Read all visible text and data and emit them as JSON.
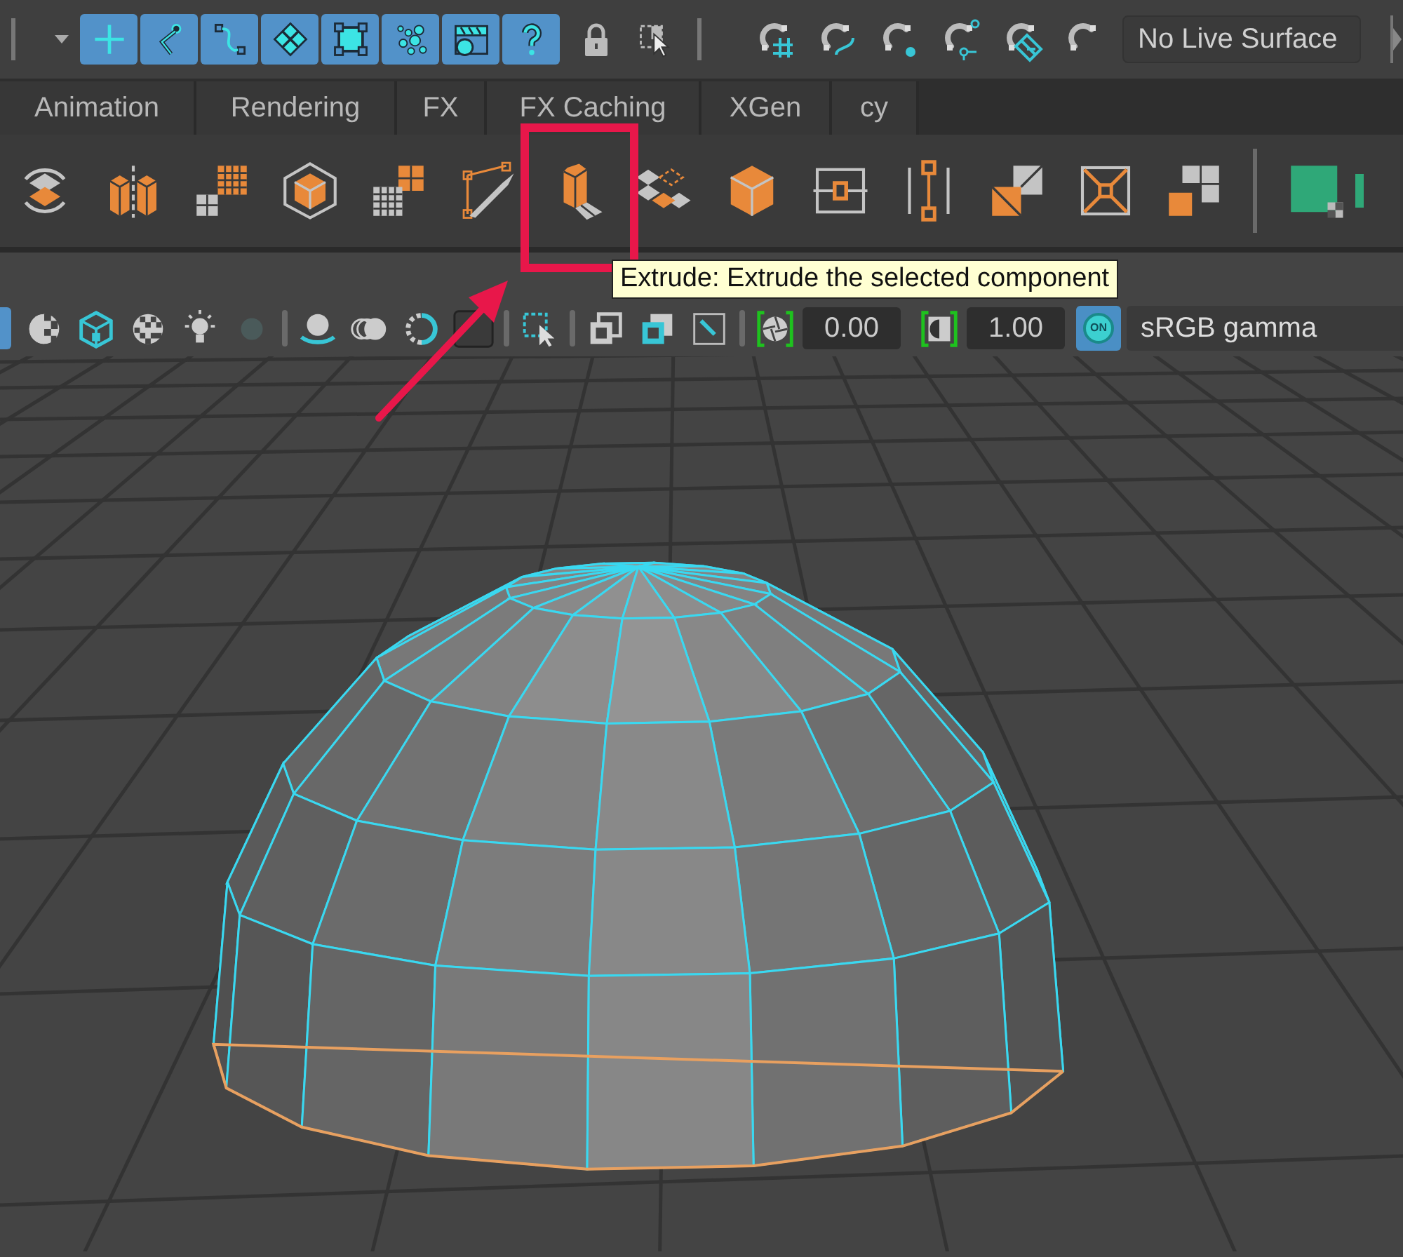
{
  "toolbar": {
    "live_surface": "No Live Surface"
  },
  "shelf_tabs": [
    {
      "label": "Animation"
    },
    {
      "label": "Rendering"
    },
    {
      "label": "FX"
    },
    {
      "label": "FX Caching"
    },
    {
      "label": "XGen"
    },
    {
      "label": "cy"
    }
  ],
  "tooltip": "Extrude: Extrude the selected component",
  "viewport_toolbar": {
    "exposure": "0.00",
    "gamma": "1.00",
    "color_management": {
      "label": "ON",
      "on": true
    },
    "color_space": "sRGB gamma"
  }
}
